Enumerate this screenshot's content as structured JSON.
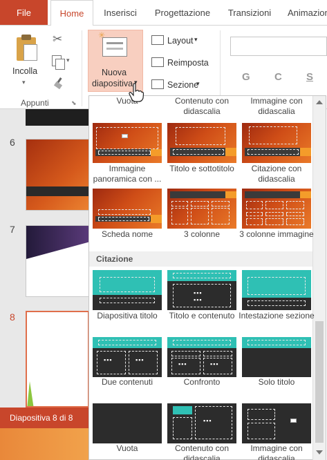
{
  "tabs": {
    "file": "File",
    "home": "Home",
    "inserisci": "Inserisci",
    "progettazione": "Progettazione",
    "transizioni": "Transizioni",
    "animazioni": "Animazioni"
  },
  "ribbon": {
    "incolla": "Incolla",
    "appunti": "Appunti",
    "nuova_line1": "Nuova",
    "nuova_line2": "diapositiva",
    "layout": "Layout",
    "reimposta": "Reimposta",
    "sezione": "Sezione",
    "bold": "G",
    "italic": "C",
    "underline": "S"
  },
  "thumbnails": {
    "slides": [
      {
        "number": "6"
      },
      {
        "number": "7"
      },
      {
        "number": "8"
      }
    ],
    "status": "Diapositiva 8 di 8"
  },
  "gallery": {
    "top_row_partial": [
      "Vuota",
      "Contenuto con didascalia",
      "Immagine con didascalia"
    ],
    "group1": [
      {
        "label": "Immagine panoramica con ..."
      },
      {
        "label": "Titolo e sottotitolo"
      },
      {
        "label": "Citazione con didascalia"
      },
      {
        "label": "Scheda nome"
      },
      {
        "label": "3 colonne"
      },
      {
        "label": "3 colonne immagine"
      }
    ],
    "section_title": "Citazione",
    "group2": [
      {
        "label": "Diapositiva titolo"
      },
      {
        "label": "Titolo e contenuto"
      },
      {
        "label": "Intestazione sezione"
      },
      {
        "label": "Due contenuti"
      },
      {
        "label": "Confronto"
      },
      {
        "label": "Solo titolo"
      },
      {
        "label": "Vuota"
      },
      {
        "label": "Contenuto con didascalia"
      },
      {
        "label": "Immagine con didascalia"
      }
    ]
  },
  "colors": {
    "accent": "#c8462b",
    "highlight": "#f8cfc0",
    "teal": "#2fc0b4",
    "orange": "#f49c2a"
  }
}
